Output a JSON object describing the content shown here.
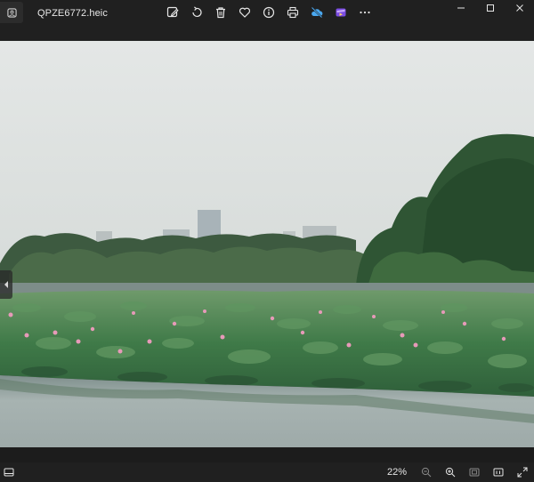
{
  "window": {
    "file_name": "QPZE6772.heic",
    "app_icon": "photos-app-icon"
  },
  "toolbar": {
    "items": [
      {
        "name": "edit-image-icon"
      },
      {
        "name": "rotate-icon"
      },
      {
        "name": "delete-icon"
      },
      {
        "name": "favorite-heart-icon"
      },
      {
        "name": "info-icon"
      },
      {
        "name": "print-icon"
      },
      {
        "name": "cloud-off-icon"
      },
      {
        "name": "clipchamp-icon"
      },
      {
        "name": "more-options-icon"
      }
    ]
  },
  "window_controls": [
    "minimize-icon",
    "maximize-icon",
    "close-icon"
  ],
  "status": {
    "zoom": "22%"
  },
  "colors": {
    "chrome_bg": "#202020",
    "sky": "#dfe3e1",
    "water": "#9aa9a8",
    "lotus_pink": "#e79ab9",
    "cloud_off_blue": "#4aa8f0",
    "clipchamp_purple": "#7b4de3"
  }
}
